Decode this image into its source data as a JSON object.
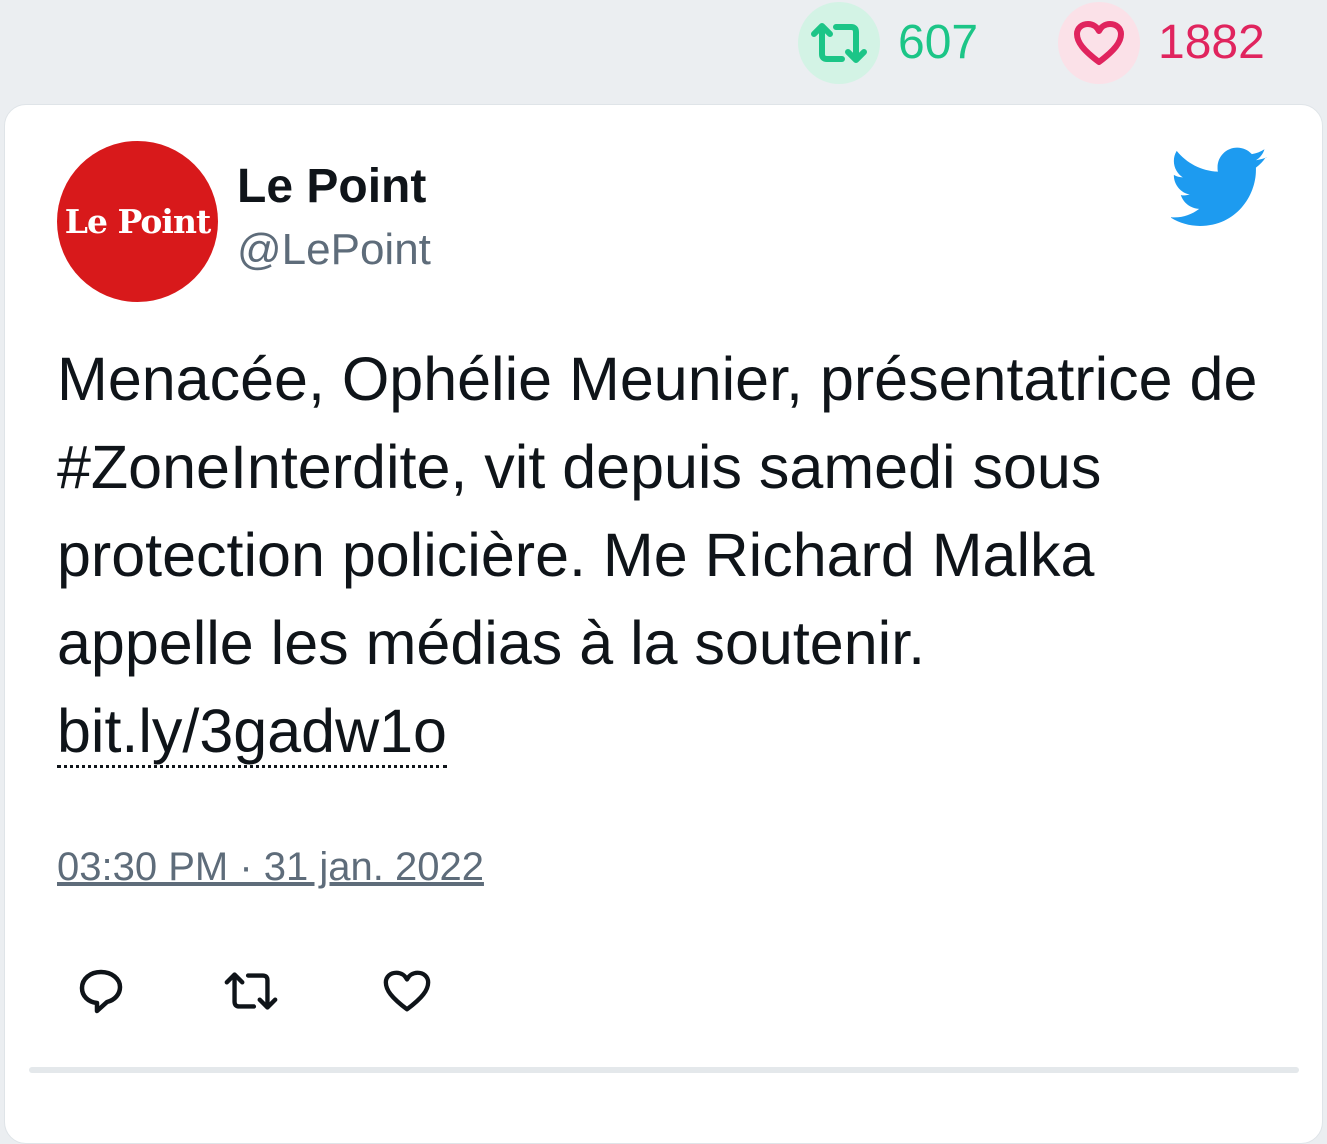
{
  "stats": {
    "retweets": "607",
    "likes": "1882",
    "retweet_color": "#1cc587",
    "like_color": "#e0245e"
  },
  "tweet": {
    "avatar_text": "Le Point",
    "author_name": "Le Point",
    "author_handle": "@LePoint",
    "text": "Menacée, Ophélie Meunier, présentatrice de #ZoneInterdite, vit depuis samedi sous protection policière. Me Richard Malka appelle les médias à la soutenir. ",
    "link": "bit.ly/3gadw1o",
    "timestamp": "03:30 PM · 31 jan. 2022"
  },
  "icons": {
    "retweet": "retweet-icon",
    "like": "heart-icon",
    "reply": "reply-icon",
    "brand": "twitter-bird-icon"
  },
  "colors": {
    "brand": "#1d9bf0",
    "avatar_bg": "#d8191b"
  }
}
